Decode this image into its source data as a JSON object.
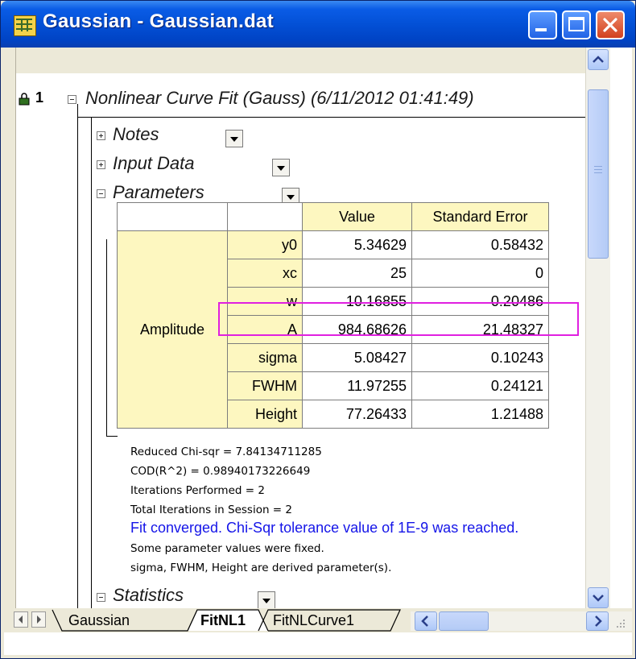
{
  "window": {
    "title": "Gaussian - Gaussian.dat",
    "icon": "worksheet-grid-icon",
    "controls": [
      "minimize-icon",
      "maximize-icon",
      "close-icon"
    ]
  },
  "report": {
    "row_number": "1",
    "heading": "Nonlinear Curve Fit (Gauss) (6/11/2012 01:41:49)",
    "sections": {
      "notes": "Notes",
      "input_data": "Input Data",
      "parameters": "Parameters",
      "statistics": "Statistics"
    }
  },
  "parameters_table": {
    "headers": [
      "",
      "",
      "Value",
      "Standard Error"
    ],
    "group_label": "Amplitude",
    "rows": [
      {
        "name": "y0",
        "value": "5.34629",
        "error": "0.58432"
      },
      {
        "name": "xc",
        "value": "25",
        "error": "0"
      },
      {
        "name": "w",
        "value": "10.16855",
        "error": "0.20486"
      },
      {
        "name": "A",
        "value": "984.68626",
        "error": "21.48327"
      },
      {
        "name": "sigma",
        "value": "5.08427",
        "error": "0.10243"
      },
      {
        "name": "FWHM",
        "value": "11.97255",
        "error": "0.24121"
      },
      {
        "name": "Height",
        "value": "77.26433",
        "error": "1.21488"
      }
    ],
    "highlight_color": "#e020e0",
    "header_color": "#fdf7c0"
  },
  "fit_info": [
    "Reduced Chi-sqr = 7.84134711285",
    "COD(R^2) = 0.98940173226649",
    "Iterations Performed = 2",
    "Total Iterations in Session = 2",
    "Fit converged. Chi-Sqr tolerance value of 1E-9 was reached.",
    "Some parameter values were fixed.",
    "sigma, FWHM, Height are derived parameter(s)."
  ],
  "fit_info_accent": "#1515e8",
  "sheet_tabs": [
    "Gaussian",
    "FitNL1",
    "FitNLCurve1"
  ],
  "active_tab": "FitNL1"
}
